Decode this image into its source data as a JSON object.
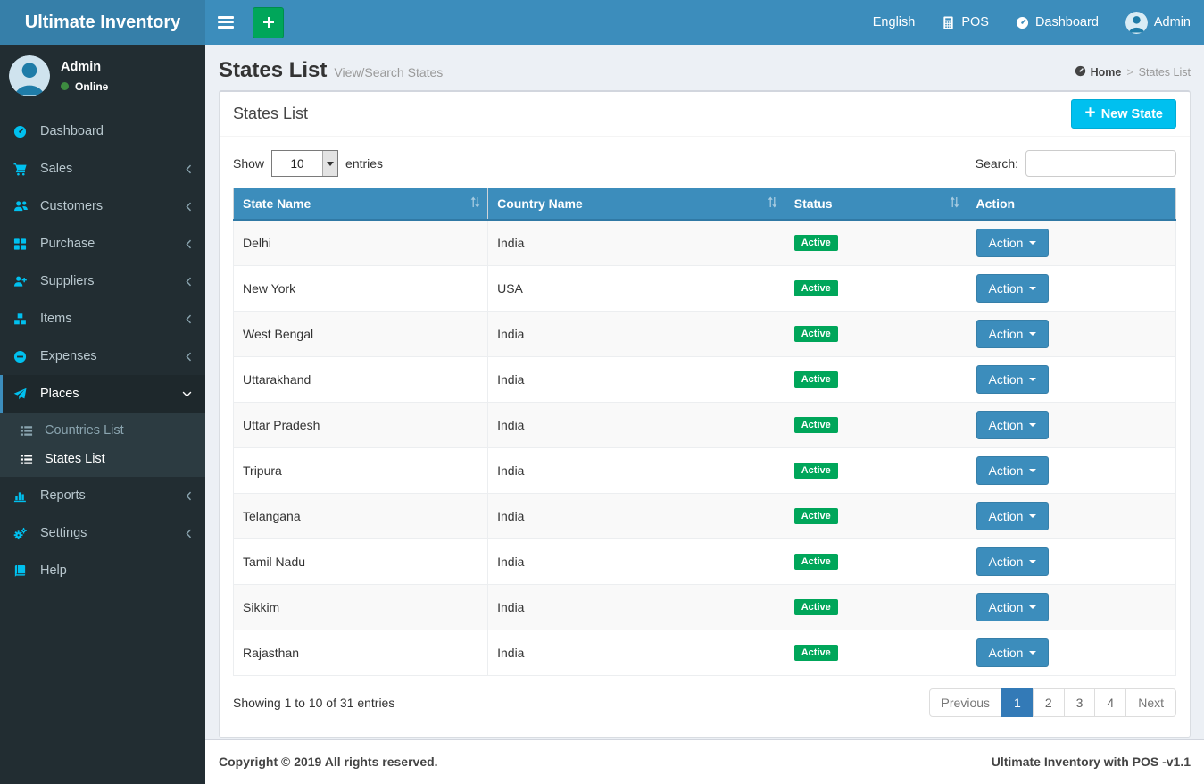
{
  "navbar": {
    "brand": "Ultimate Inventory",
    "language": "English",
    "pos": "POS",
    "dashboard": "Dashboard",
    "user": "Admin"
  },
  "sidebar": {
    "user": {
      "name": "Admin",
      "status": "Online"
    },
    "items": [
      {
        "label": "Dashboard"
      },
      {
        "label": "Sales"
      },
      {
        "label": "Customers"
      },
      {
        "label": "Purchase"
      },
      {
        "label": "Suppliers"
      },
      {
        "label": "Items"
      },
      {
        "label": "Expenses"
      },
      {
        "label": "Places"
      },
      {
        "label": "Reports"
      },
      {
        "label": "Settings"
      },
      {
        "label": "Help"
      }
    ],
    "submenu": [
      {
        "label": "Countries List"
      },
      {
        "label": "States List"
      }
    ]
  },
  "content_header": {
    "title": "States List",
    "subtitle": "View/Search States",
    "breadcrumb_home": "Home",
    "breadcrumb_current": "States List"
  },
  "panel": {
    "title": "States List",
    "new_state_label": "New State"
  },
  "controls": {
    "show_label": "Show",
    "page_length": "10",
    "entries_label": "entries",
    "search_label": "Search:",
    "search_value": ""
  },
  "table": {
    "headers": [
      "State Name",
      "Country Name",
      "Status",
      "Action"
    ],
    "action_label": "Action",
    "rows": [
      {
        "state": "Delhi",
        "country": "India",
        "status": "Active"
      },
      {
        "state": "New York",
        "country": "USA",
        "status": "Active"
      },
      {
        "state": "West Bengal",
        "country": "India",
        "status": "Active"
      },
      {
        "state": "Uttarakhand",
        "country": "India",
        "status": "Active"
      },
      {
        "state": "Uttar Pradesh",
        "country": "India",
        "status": "Active"
      },
      {
        "state": "Tripura",
        "country": "India",
        "status": "Active"
      },
      {
        "state": "Telangana",
        "country": "India",
        "status": "Active"
      },
      {
        "state": "Tamil Nadu",
        "country": "India",
        "status": "Active"
      },
      {
        "state": "Sikkim",
        "country": "India",
        "status": "Active"
      },
      {
        "state": "Rajasthan",
        "country": "India",
        "status": "Active"
      }
    ]
  },
  "pagination": {
    "info": "Showing 1 to 10 of 31 entries",
    "previous": "Previous",
    "pages": [
      "1",
      "2",
      "3",
      "4"
    ],
    "active_page": "1",
    "next": "Next"
  },
  "footer": {
    "copyright": "Copyright © 2019 All rights reserved.",
    "version": "Ultimate Inventory with POS -v1.1"
  },
  "colors": {
    "navbar": "#3c8dbc",
    "brand_bg": "#367fa9",
    "sidebar_bg": "#222d32",
    "submenu_bg": "#2c3b41",
    "sidebar_icon": "#00c0ef",
    "table_header": "#3c8dbc",
    "badge_active": "#00a65a",
    "new_state_btn": "#00c0ef",
    "pagination_active": "#337ab7",
    "content_bg": "#ecf0f5"
  },
  "icons": {
    "hamburger": "three-bars",
    "plus": "+",
    "calculator": "grid-calculator",
    "tachometer": "gauge",
    "caret_down": "▾",
    "sort": "⇅",
    "chevron_left": "‹",
    "chevron_down": "⌄"
  }
}
